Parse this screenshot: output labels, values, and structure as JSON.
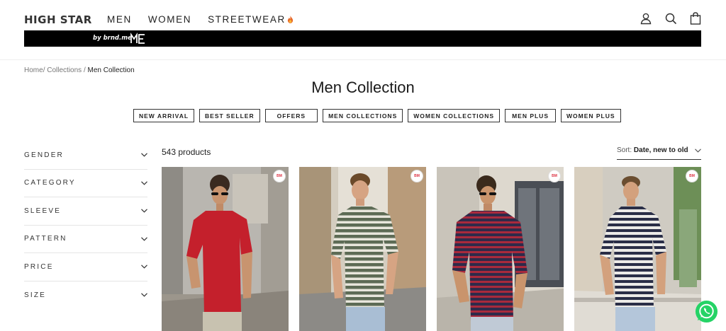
{
  "header": {
    "logo": "HIGH STAR",
    "nav": [
      {
        "label": "MEN"
      },
      {
        "label": "WOMEN"
      },
      {
        "label": "STREETWEAR"
      }
    ],
    "icons": [
      "user-icon",
      "search-icon",
      "cart-icon"
    ]
  },
  "banner": {
    "text": "by brnd.me",
    "logo_text": "ME"
  },
  "breadcrumb": {
    "home": "Home",
    "collections": "Collections",
    "current": "Men Collection"
  },
  "page_title": "Men Collection",
  "pills": [
    "NEW ARRIVAL",
    "BEST SELLER",
    "OFFERS",
    "MEN COLLECTIONS",
    "WOMEN COLLECTIONS",
    "MEN PLUS",
    "WOMEN PLUS"
  ],
  "filters": [
    "GENDER",
    "CATEGORY",
    "SLEEVE",
    "PATTERN",
    "PRICE",
    "SIZE"
  ],
  "product_count": "543 products",
  "sort": {
    "label": "Sort:",
    "value": "Date, new to old"
  },
  "colors": {
    "banner_bg": "#000000",
    "whatsapp": "#25D366",
    "tee_red": "#c4202c",
    "tee_green_stripe": "#5d6b55",
    "tee_maroon_stripe": "#6d2335",
    "tee_navy_stripe": "#2a2e47"
  }
}
